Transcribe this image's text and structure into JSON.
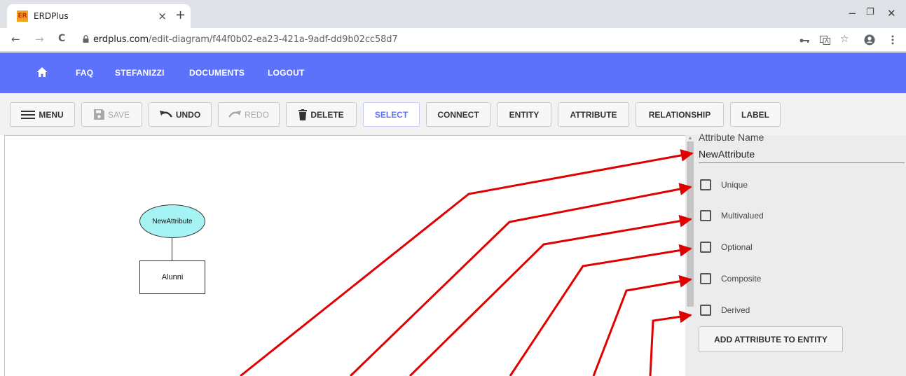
{
  "browser": {
    "tab_title": "ERDPlus",
    "favicon_text": "ER",
    "tab_close": "×",
    "new_tab": "+",
    "url_domain": "erdplus.com",
    "url_path": "/edit-diagram/f44f0b02-ea23-421a-9adf-dd9b02cc58d7",
    "controls": {
      "minimize": "−",
      "restore": "❐",
      "close": "✕"
    },
    "nav": {
      "back": "←",
      "forward": "→",
      "reload": "C"
    },
    "icons": [
      "key-icon",
      "translate-icon",
      "star-icon",
      "account-icon",
      "more-icon"
    ]
  },
  "appbar": {
    "home_icon": "home-icon",
    "items": [
      "FAQ",
      "STEFANIZZI",
      "DOCUMENTS",
      "LOGOUT"
    ]
  },
  "toolbar": {
    "menu": "MENU",
    "save": "SAVE",
    "undo": "UNDO",
    "redo": "REDO",
    "delete": "DELETE",
    "select": "SELECT",
    "connect": "CONNECT",
    "entity": "ENTITY",
    "attribute": "ATTRIBUTE",
    "relationship": "RELATIONSHIP",
    "label": "LABEL",
    "active": "SELECT",
    "disabled": [
      "SAVE",
      "REDO"
    ]
  },
  "diagram": {
    "attribute_name": "NewAttribute",
    "entity_name": "Alunni",
    "attribute_fill": "#a5f3f3"
  },
  "panel": {
    "field_label": "Attribute Name",
    "field_value": "NewAttribute",
    "checkboxes": [
      {
        "label": "Unique",
        "checked": false
      },
      {
        "label": "Multivalued",
        "checked": false
      },
      {
        "label": "Optional",
        "checked": false
      },
      {
        "label": "Composite",
        "checked": false
      },
      {
        "label": "Derived",
        "checked": false
      }
    ],
    "add_button": "ADD ATTRIBUTE TO ENTITY"
  },
  "colors": {
    "brand": "#5c72fa",
    "annotation_arrows": "#e00000",
    "panel_bg": "#ececec"
  }
}
